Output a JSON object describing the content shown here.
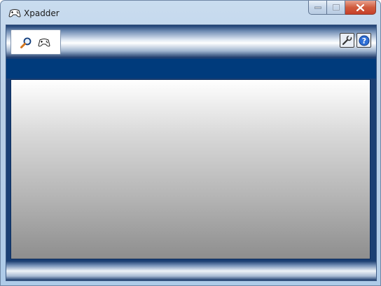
{
  "window": {
    "title": "Xpadder",
    "app_icon": "gamepad-icon",
    "controls": {
      "minimize": "minimize-icon",
      "maximize": "maximize-icon",
      "close": "close-icon"
    }
  },
  "toolbar": {
    "left_icons": [
      "search-icon",
      "gamepad-icon"
    ],
    "right_icons": [
      "wrench-icon",
      "help-icon"
    ]
  },
  "colors": {
    "header_blue": "#003b7c",
    "close_red": "#c7402a"
  }
}
